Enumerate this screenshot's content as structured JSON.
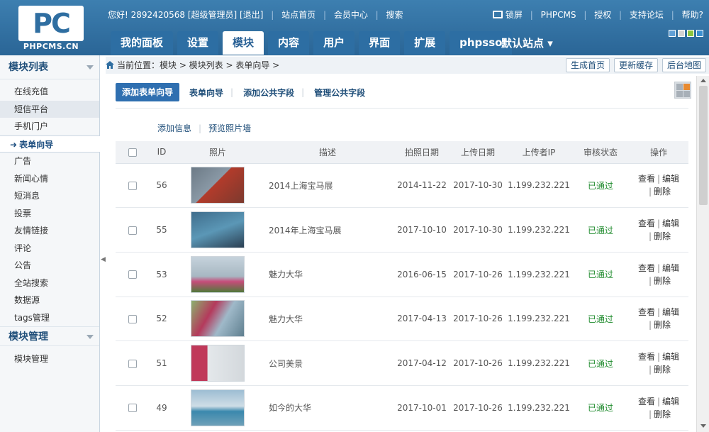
{
  "logo": {
    "mark": "PC",
    "text": "PHPCMS.CN"
  },
  "topbar": {
    "greeting": "您好!",
    "user": "2892420568",
    "role": "[超级管理员]",
    "logout": "[退出]",
    "home": "站点首页",
    "member": "会员中心",
    "search": "搜索"
  },
  "toplinks": {
    "lock": "锁屏",
    "phpcms": "PHPCMS",
    "license": "授权",
    "forum": "支持论坛",
    "help": "帮助?"
  },
  "tabs": [
    {
      "label": "我的面板"
    },
    {
      "label": "设置"
    },
    {
      "label": "模块"
    },
    {
      "label": "内容"
    },
    {
      "label": "用户"
    },
    {
      "label": "界面"
    },
    {
      "label": "扩展"
    },
    {
      "label": "phpsso"
    }
  ],
  "site_selector": "默认站点",
  "colors": [
    "#62a0d6",
    "#d2d2d2",
    "#8bc53f",
    "#3b8fd0"
  ],
  "sidebar": {
    "section1": "模块列表",
    "items": [
      {
        "label": "在线充值"
      },
      {
        "label": "短信平台"
      },
      {
        "label": "手机门户"
      },
      {
        "label": "表单向导"
      },
      {
        "label": "广告"
      },
      {
        "label": "新闻心情"
      },
      {
        "label": "短消息"
      },
      {
        "label": "投票"
      },
      {
        "label": "友情链接"
      },
      {
        "label": "评论"
      },
      {
        "label": "公告"
      },
      {
        "label": "全站搜索"
      },
      {
        "label": "数据源"
      },
      {
        "label": "tags管理"
      }
    ],
    "section2": "模块管理",
    "items2": [
      {
        "label": "模块管理"
      }
    ]
  },
  "breadcrumb": {
    "text": "当前位置：模块 > 模块列表 > 表单向导 >",
    "buttons": [
      "生成首页",
      "更新缓存",
      "后台地图"
    ]
  },
  "subnav": {
    "primary": "添加表单向导",
    "links": [
      "表单向导",
      "添加公共字段",
      "管理公共字段"
    ]
  },
  "actions": [
    "添加信息",
    "预览照片墙"
  ],
  "table": {
    "headers": [
      "ID",
      "照片",
      "描述",
      "拍照日期",
      "上传日期",
      "上传者IP",
      "审核状态",
      "操作"
    ],
    "rows": [
      {
        "id": "56",
        "desc": "2014上海宝马展",
        "shot": "2014-11-22",
        "upload": "2017-10-30",
        "ip": "1.199.232.221",
        "status": "已通过",
        "thumb": [
          "#6c7a86",
          "#b23b2b"
        ]
      },
      {
        "id": "55",
        "desc": "2014年上海宝马展",
        "shot": "2017-10-10",
        "upload": "2017-10-30",
        "ip": "1.199.232.221",
        "status": "已通过",
        "thumb": [
          "#3f6d8c",
          "#5b97b6"
        ]
      },
      {
        "id": "53",
        "desc": "魅力大华",
        "shot": "2016-06-15",
        "upload": "2017-10-26",
        "ip": "1.199.232.221",
        "status": "已通过",
        "thumb": [
          "#c6d3dc",
          "#c64d7a"
        ]
      },
      {
        "id": "52",
        "desc": "魅力大华",
        "shot": "2017-04-13",
        "upload": "2017-10-26",
        "ip": "1.199.232.221",
        "status": "已通过",
        "thumb": [
          "#8bb06d",
          "#b43a5c"
        ]
      },
      {
        "id": "51",
        "desc": "公司美景",
        "shot": "2017-04-12",
        "upload": "2017-10-26",
        "ip": "1.199.232.221",
        "status": "已通过",
        "thumb": [
          "#e4e8eb",
          "#c0395a"
        ]
      },
      {
        "id": "49",
        "desc": "如今的大华",
        "shot": "2017-10-01",
        "upload": "2017-10-26",
        "ip": "1.199.232.221",
        "status": "已通过",
        "thumb": [
          "#9dbdd3",
          "#3a88ad"
        ]
      }
    ],
    "op_view": "查看",
    "op_edit": "编辑",
    "op_delete": "删除"
  }
}
